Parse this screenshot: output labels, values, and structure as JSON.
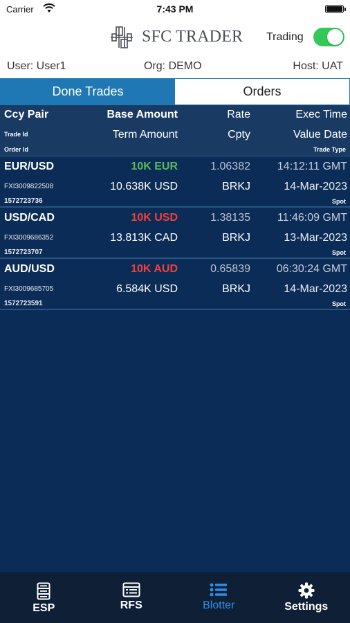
{
  "status_bar": {
    "carrier": "Carrier",
    "time": "7:43 PM",
    "battery_level": 1.0
  },
  "header": {
    "app_title": "SFC TRADER",
    "trading_label": "Trading",
    "trading_enabled": true,
    "toggle_color": "#34c759"
  },
  "info": {
    "user": "User: User1",
    "org": "Org: DEMO",
    "host": "Host: UAT"
  },
  "tabs": [
    {
      "label": "Done Trades",
      "active": true
    },
    {
      "label": "Orders",
      "active": false
    }
  ],
  "columns": {
    "ccy_pair": "Ccy Pair",
    "base_amount": "Base Amount",
    "rate": "Rate",
    "exec_time": "Exec Time",
    "trade_id": "Trade Id",
    "term_amount": "Term Amount",
    "cpty": "Cpty",
    "value_date": "Value Date",
    "order_id": "Order Id",
    "trade_type": "Trade Type"
  },
  "trades": [
    {
      "pair": "EUR/USD",
      "base_amount": "10K EUR",
      "base_color": "#5cb85c",
      "rate": "1.06382",
      "exec_time": "14:12:11 GMT",
      "trade_id": "FXI3009822508",
      "term_amount": "10.638K USD",
      "cpty": "BRKJ",
      "value_date": "14-Mar-2023",
      "order_id": "1572723736",
      "trade_type": "Spot"
    },
    {
      "pair": "USD/CAD",
      "base_amount": "10K USD",
      "base_color": "#f0413c",
      "rate": "1.38135",
      "exec_time": "11:46:09 GMT",
      "trade_id": "FXI3009686352",
      "term_amount": "13.813K CAD",
      "cpty": "BRKJ",
      "value_date": "13-Mar-2023",
      "order_id": "1572723707",
      "trade_type": "Spot"
    },
    {
      "pair": "AUD/USD",
      "base_amount": "10K AUD",
      "base_color": "#f0413c",
      "rate": "0.65839",
      "exec_time": "06:30:24 GMT",
      "trade_id": "FXI3009685705",
      "term_amount": "6.584K USD",
      "cpty": "BRKJ",
      "value_date": "14-Mar-2023",
      "order_id": "1572723591",
      "trade_type": "Spot"
    }
  ],
  "tabbar": [
    {
      "label": "ESP",
      "icon": "server-icon",
      "active": false
    },
    {
      "label": "RFS",
      "icon": "list-box-icon",
      "active": false
    },
    {
      "label": "Blotter",
      "icon": "bullet-list-icon",
      "active": true
    },
    {
      "label": "Settings",
      "icon": "gear-icon",
      "active": false
    }
  ],
  "colors": {
    "accent": "#1f78b4",
    "blotter_bg": "#0b2c56",
    "header_bg": "#183a63",
    "tabbar_bg": "#0f2036",
    "tabbar_active": "#2e8fe8"
  }
}
